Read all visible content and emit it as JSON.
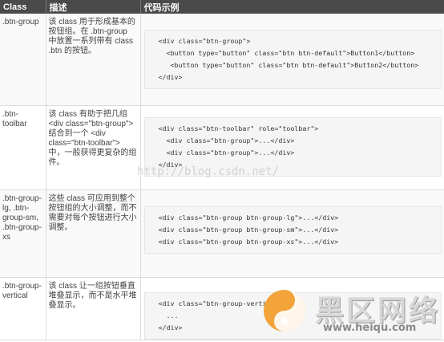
{
  "header": {
    "col1": "Class",
    "col2": "描述",
    "col3": "代码示例"
  },
  "rows": [
    {
      "cls": ".btn-group",
      "desc": "该 class 用于形成基本的按钮组。在 .btn-group 中放置一系列带有 class .btn 的按钮。",
      "code": [
        "<div class=\"btn-group\">",
        "  <button type=\"button\" class=\"btn btn-default\">Button1</button>",
        "   <button type=\"button\" class=\"btn btn-default\">Button2</button>",
        "</div>"
      ]
    },
    {
      "cls": ".btn-toolbar",
      "desc": "该 class 有助于把几组 <div class=\"btn-group\"> 结合到一个 <div class=\"btn-toolbar\"> 中，一般获得更复杂的组件。",
      "code": [
        "<div class=\"btn-toolbar\" role=\"toolbar\">",
        "  <div class=\"btn-group\">...</div>",
        "  <div class=\"btn-group\">...</div>",
        "</div>"
      ]
    },
    {
      "cls": ".btn-group-lg, .btn-group-sm, .btn-group-xs",
      "desc": "这些 class 可应用到整个按钮组的大小调整，而不需要对每个按钮进行大小调整。",
      "code": [
        "<div class=\"btn-group btn-group-lg\">...</div>",
        "<div class=\"btn-group btn-group-sm\">...</div>",
        "<div class=\"btn-group btn-group-xs\">...</div>"
      ]
    },
    {
      "cls": ".btn-group-vertical",
      "desc": "该 class 让一组按钮垂直堆叠显示，而不是水平堆叠显示。",
      "code": [
        "<div class=\"btn-group-vertical\">",
        "  ...",
        "</div>"
      ]
    }
  ],
  "watermark": "http://blog.csdn.net/",
  "logo": {
    "name": "黑区网络",
    "url": "www.heiqu.com"
  }
}
